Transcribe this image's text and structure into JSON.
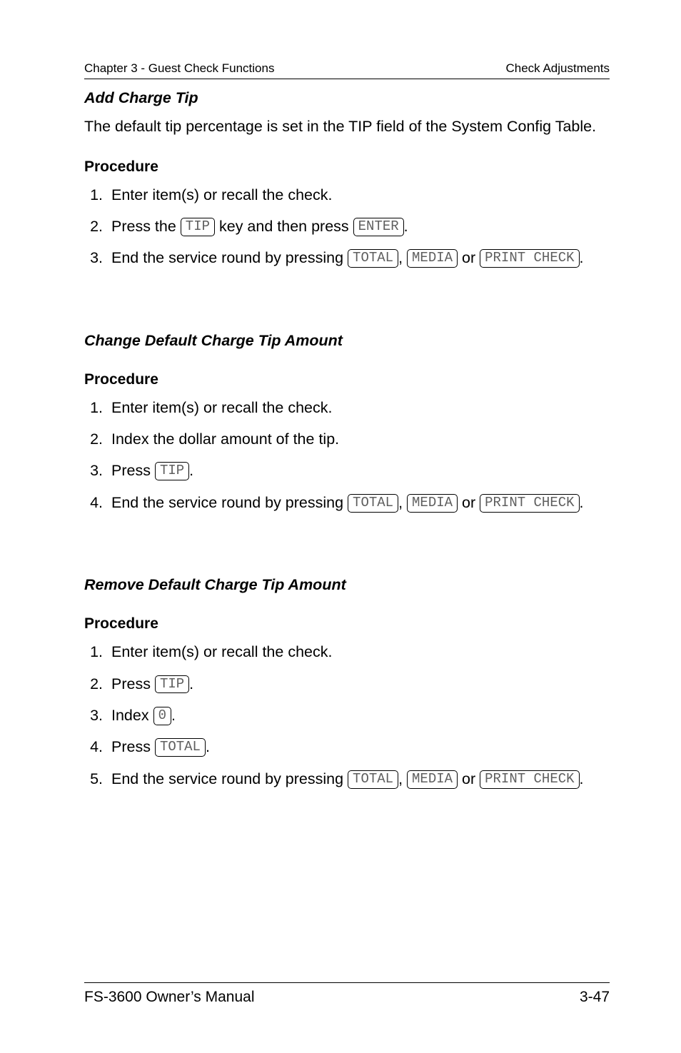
{
  "header": {
    "left": "Chapter 3 - Guest Check Functions",
    "right": "Check Adjustments"
  },
  "sections": {
    "s1": {
      "title": "Add Charge Tip",
      "para": "The default tip percentage is set in the TIP field of the System Config Table.",
      "proc_label": "Procedure",
      "steps": {
        "a": {
          "t1": "Enter item(s) or recall the check."
        },
        "b": {
          "t1": "Press the ",
          "k1": "TIP",
          "t2": " key and then press ",
          "k2": "ENTER",
          "t3": "."
        },
        "c": {
          "t1": "End the service round by pressing ",
          "k1": "TOTAL",
          "t2": ", ",
          "k2": "MEDIA",
          "t3": " or ",
          "k3": "PRINT CHECK",
          "t4": "."
        }
      }
    },
    "s2": {
      "title": "Change Default Charge Tip Amount",
      "proc_label": "Procedure",
      "steps": {
        "a": {
          "t1": "Enter item(s) or recall the check."
        },
        "b": {
          "t1": "Index the dollar amount of the tip."
        },
        "c": {
          "t1": "Press ",
          "k1": "TIP",
          "t2": "."
        },
        "d": {
          "t1": "End the service round by pressing ",
          "k1": "TOTAL",
          "t2": ", ",
          "k2": "MEDIA",
          "t3": " or ",
          "k3": "PRINT CHECK",
          "t4": "."
        }
      }
    },
    "s3": {
      "title": "Remove Default Charge Tip Amount",
      "proc_label": "Procedure",
      "steps": {
        "a": {
          "t1": "Enter item(s) or recall the check."
        },
        "b": {
          "t1": "Press ",
          "k1": "TIP",
          "t2": "."
        },
        "c": {
          "t1": "Index ",
          "k1": "0",
          "t2": "."
        },
        "d": {
          "t1": "Press ",
          "k1": "TOTAL",
          "t2": "."
        },
        "e": {
          "t1": "End the service round by pressing ",
          "k1": "TOTAL",
          "t2": ", ",
          "k2": "MEDIA",
          "t3": " or ",
          "k3": "PRINT CHECK",
          "t4": "."
        }
      }
    }
  },
  "footer": {
    "left": "FS-3600 Owner’s Manual",
    "right": "3-47"
  }
}
